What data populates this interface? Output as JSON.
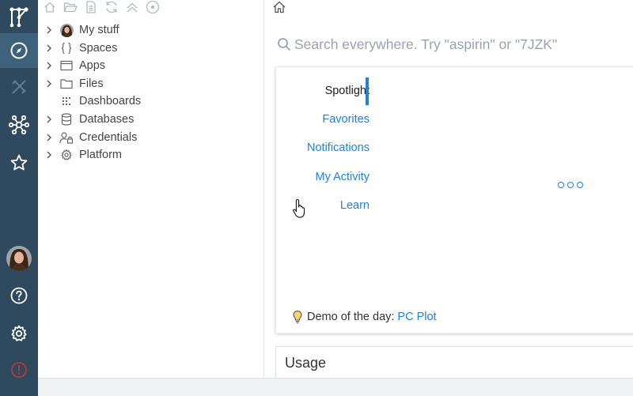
{
  "colors": {
    "rail_bg": "#2f4a5e",
    "rail_active": "#3e627c",
    "accent": "#2083d5",
    "error": "#c0392b"
  },
  "rail": {
    "items": [
      {
        "icon": "datagrok-logo-icon"
      },
      {
        "icon": "compass-icon",
        "active": true
      },
      {
        "icon": "tools-icon"
      },
      {
        "icon": "network-icon"
      },
      {
        "icon": "star-icon"
      },
      {
        "icon": "avatar"
      },
      {
        "icon": "help-icon"
      },
      {
        "icon": "gear-icon"
      },
      {
        "icon": "error-icon"
      }
    ]
  },
  "toolbar": {
    "icons": [
      "home-icon",
      "open-folder-icon",
      "document-icon",
      "refresh-icon",
      "collapse-icon",
      "target-icon"
    ]
  },
  "tree": {
    "items": [
      {
        "label": "My stuff",
        "icon": "avatar-icon",
        "expandable": true
      },
      {
        "label": "Spaces",
        "icon": "braces-icon",
        "expandable": true
      },
      {
        "label": "Apps",
        "icon": "window-icon",
        "expandable": true
      },
      {
        "label": "Files",
        "icon": "folder-icon",
        "expandable": true
      },
      {
        "label": "Dashboards",
        "icon": "grid-dots-icon",
        "expandable": false
      },
      {
        "label": "Databases",
        "icon": "database-icon",
        "expandable": true
      },
      {
        "label": "Credentials",
        "icon": "user-lock-icon",
        "expandable": true
      },
      {
        "label": "Platform",
        "icon": "gear-icon",
        "expandable": true
      }
    ]
  },
  "search": {
    "placeholder": "Search everywhere. Try \"aspirin\" or \"7JZK\"",
    "value": ""
  },
  "tabs": {
    "items": [
      "Spotlight",
      "Favorites",
      "Notifications",
      "My Activity",
      "Learn"
    ],
    "selected": "Spotlight"
  },
  "demo": {
    "prefix": "Demo of the day:",
    "link": "PC Plot"
  },
  "usage": {
    "title": "Usage"
  }
}
